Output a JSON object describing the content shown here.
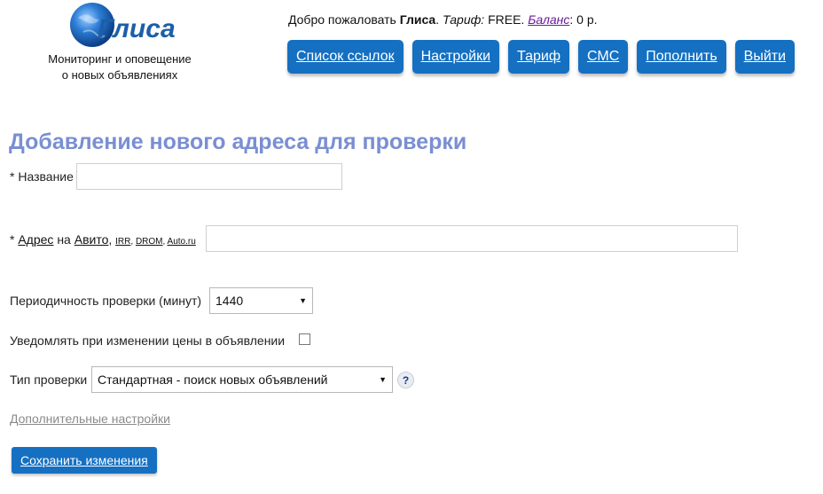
{
  "brand": {
    "logo_text": "Глиса",
    "tagline_line1": "Мониторинг и оповещение",
    "tagline_line2": "о новых объявлениях"
  },
  "welcome": {
    "greeting": "Добро пожаловать ",
    "user": "Глиса",
    "tariff_label": "Тариф:",
    "tariff_value": " FREE. ",
    "balance_link": "Баланс",
    "balance_value": ": 0 р."
  },
  "nav": {
    "links": "Список ссылок",
    "settings": "Настройки",
    "tariff": "Тариф",
    "sms": "СМС",
    "topup": "Пополнить",
    "logout": "Выйти"
  },
  "form": {
    "title": "Добавление нового адреса для проверки",
    "name_label": "* Название",
    "name_value": "",
    "address_prefix": "* ",
    "address_link": "Адрес",
    "address_on": " на ",
    "site_avito": "Авито",
    "site_irr": "IRR",
    "site_drom": "DROM",
    "site_autoru": "Auto.ru",
    "address_value": "",
    "period_label": "Периодичность проверки (минут)",
    "period_value": "1440",
    "notify_label": "Уведомлять при изменении цены в объявлении",
    "notify_checked": false,
    "type_label": "Тип проверки",
    "type_value": "Стандартная - поиск новых объявлений",
    "help_symbol": "?",
    "extra_settings": "Дополнительные настройки",
    "save": "Сохранить изменения"
  },
  "colors": {
    "accent": "#1570c2",
    "heading": "#7a8fd1"
  }
}
